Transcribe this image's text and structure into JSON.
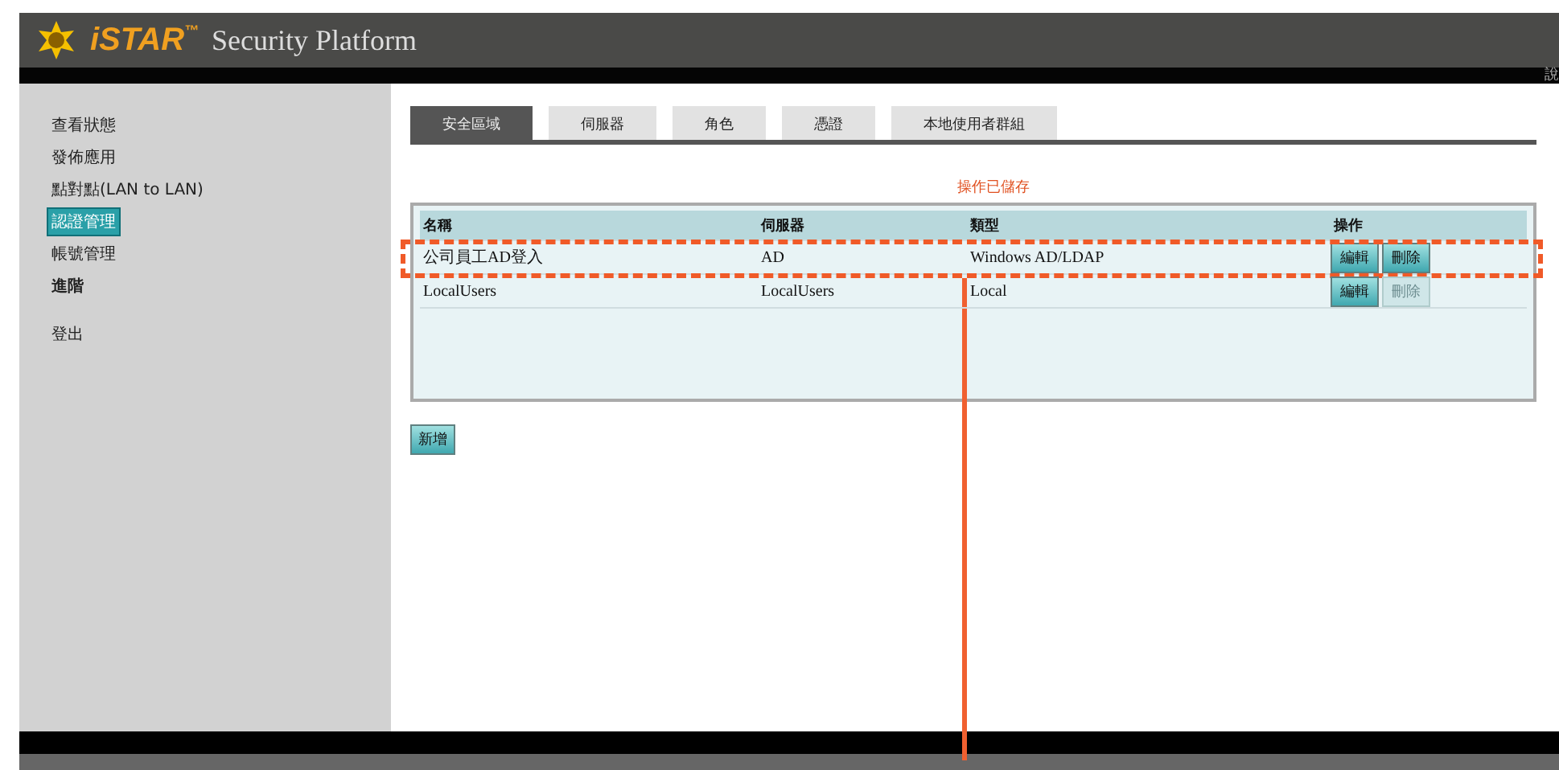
{
  "header": {
    "brand": "iSTAR",
    "trademark": "™",
    "subtitle": "Security Platform",
    "corner_text": "說"
  },
  "sidebar": {
    "items": [
      {
        "label": "查看狀態",
        "selected": false,
        "bold": false
      },
      {
        "label": "發佈應用",
        "selected": false,
        "bold": false
      },
      {
        "label": "點對點(LAN to LAN)",
        "selected": false,
        "bold": false
      },
      {
        "label": "認證管理",
        "selected": true,
        "bold": false
      },
      {
        "label": "帳號管理",
        "selected": false,
        "bold": false
      },
      {
        "label": "進階",
        "selected": false,
        "bold": true
      },
      {
        "label": "登出",
        "selected": false,
        "bold": false
      }
    ]
  },
  "tabs": [
    {
      "label": "安全區域",
      "selected": true
    },
    {
      "label": "伺服器",
      "selected": false
    },
    {
      "label": "角色",
      "selected": false
    },
    {
      "label": "憑證",
      "selected": false
    },
    {
      "label": "本地使用者群組",
      "selected": false
    }
  ],
  "message": "操作已儲存",
  "table": {
    "columns": [
      "名稱",
      "伺服器",
      "類型",
      "操作"
    ],
    "rows": [
      {
        "cells": [
          "公司員工AD登入",
          "AD",
          "Windows AD/LDAP"
        ],
        "actions": [
          {
            "label": "編輯",
            "disabled": false
          },
          {
            "label": "刪除",
            "disabled": false
          }
        ],
        "highlighted": true
      },
      {
        "cells": [
          "LocalUsers",
          "LocalUsers",
          "Local"
        ],
        "actions": [
          {
            "label": "編輯",
            "disabled": false
          },
          {
            "label": "刪除",
            "disabled": true
          }
        ],
        "highlighted": false
      }
    ]
  },
  "add_button": "新增"
}
